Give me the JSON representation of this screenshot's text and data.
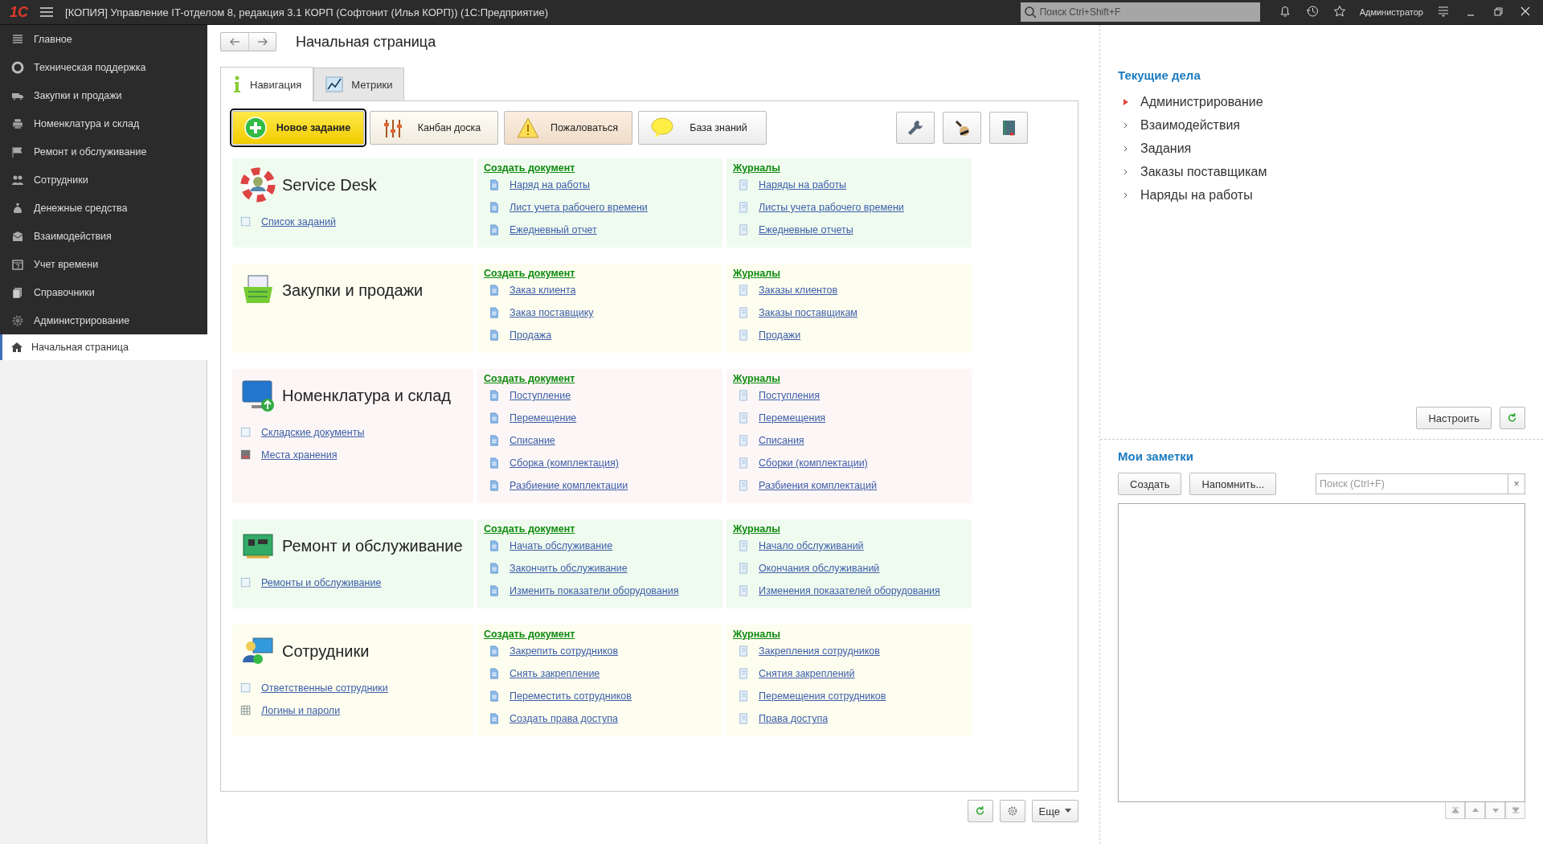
{
  "window": {
    "logo": "1С",
    "title": "[КОПИЯ] Управление IT-отделом 8, редакция 3.1 КОРП (Софтонит (Илья КОРП))  (1С:Предприятие)",
    "search": {
      "placeholder": "Поиск Ctrl+Shift+F"
    },
    "user": "Администратор"
  },
  "sidebar": {
    "items": [
      {
        "label": "Главное",
        "selected": false
      },
      {
        "label": "Техническая поддержка",
        "selected": false
      },
      {
        "label": "Закупки и продажи",
        "selected": false
      },
      {
        "label": "Номенклатура и склад",
        "selected": false
      },
      {
        "label": "Ремонт и обслуживание",
        "selected": false
      },
      {
        "label": "Сотрудники",
        "selected": false
      },
      {
        "label": "Денежные средства",
        "selected": false
      },
      {
        "label": "Взаимодействия",
        "selected": false
      },
      {
        "label": "Учет времени",
        "selected": false
      },
      {
        "label": "Справочники",
        "selected": false
      },
      {
        "label": "Администрирование",
        "selected": false
      },
      {
        "label": "Начальная страница",
        "selected": true
      }
    ]
  },
  "page": {
    "title": "Начальная страница",
    "tabs": [
      {
        "label": "Навигация",
        "selected": true
      },
      {
        "label": "Метрики",
        "selected": false
      }
    ],
    "actions": [
      {
        "label": "Новое задание",
        "kind": "primary"
      },
      {
        "label": "Канбан доска",
        "kind": "kanban"
      },
      {
        "label": "Пожаловаться",
        "kind": "warning"
      },
      {
        "label": "База знаний",
        "kind": "help"
      }
    ],
    "sections": [
      {
        "title": "Service Desk",
        "color": "#f0fbf0",
        "links": [
          {
            "label": "Список заданий",
            "kind": "list"
          }
        ],
        "create": {
          "heading": "Создать документ",
          "links": [
            "Наряд на работы",
            "Лист учета рабочего времени",
            "Ежедневный отчет"
          ]
        },
        "journals": {
          "heading": "Журналы",
          "links": [
            "Наряды на работы",
            "Листы учета рабочего времени",
            "Ежедневные отчеты"
          ]
        }
      },
      {
        "title": "Закупки и продажи",
        "color": "#fdfdf0",
        "create": {
          "heading": "Создать документ",
          "links": [
            "Заказ клиента",
            "Заказ поставщику",
            "Продажа"
          ]
        },
        "journals": {
          "heading": "Журналы",
          "links": [
            "Заказы клиентов",
            "Заказы поставщикам",
            "Продажи"
          ]
        }
      },
      {
        "title": "Номенклатура и склад",
        "color": "#fdf6f6",
        "links": [
          {
            "label": "Складские документы",
            "kind": "list"
          },
          {
            "label": "Места хранения",
            "kind": "storage"
          }
        ],
        "create": {
          "heading": "Создать документ",
          "links": [
            "Поступление",
            "Перемещение",
            "Списание",
            "Сборка (комплектация)",
            "Разбиение комплектации"
          ]
        },
        "journals": {
          "heading": "Журналы",
          "links": [
            "Поступления",
            "Перемещения",
            "Списания",
            "Сборки (комплектации)",
            "Разбиения комплектаций"
          ]
        }
      },
      {
        "title": "Ремонт и обслуживание",
        "color": "#f0fbf0",
        "links": [
          {
            "label": "Ремонты и обслуживание",
            "kind": "list"
          }
        ],
        "create": {
          "heading": "Создать документ",
          "links": [
            "Начать обслуживание",
            "Закончить обслуживание",
            "Изменить показатели оборудования"
          ]
        },
        "journals": {
          "heading": "Журналы",
          "links": [
            "Начало обслуживаний",
            "Окончания обслуживаний",
            "Изменения показателей оборудования"
          ]
        }
      },
      {
        "title": "Сотрудники",
        "color": "#fdfdf0",
        "links": [
          {
            "label": "Ответственные сотрудники",
            "kind": "list"
          },
          {
            "label": "Логины и пароли",
            "kind": "table"
          }
        ],
        "create": {
          "heading": "Создать документ",
          "links": [
            "Закрепить сотрудников",
            "Снять закрепление",
            "Переместить сотрудников",
            "Создать права доступа"
          ]
        },
        "journals": {
          "heading": "Журналы",
          "links": [
            "Закрепления сотрудников",
            "Снятия закреплений",
            "Перемещения сотрудников",
            "Права доступа"
          ]
        }
      }
    ],
    "more_button": "Еще"
  },
  "current_tasks": {
    "title": "Текущие дела",
    "items": [
      {
        "label": "Администрирование",
        "highlighted": true
      },
      {
        "label": "Взаимодействия",
        "highlighted": false
      },
      {
        "label": "Задания",
        "highlighted": false
      },
      {
        "label": "Заказы поставщикам",
        "highlighted": false
      },
      {
        "label": "Наряды на работы",
        "highlighted": false
      }
    ],
    "configure_button": "Настроить"
  },
  "notes": {
    "title": "Мои заметки",
    "buttons": [
      "Создать",
      "Напомнить..."
    ],
    "search": {
      "placeholder": "Поиск (Ctrl+F)"
    },
    "clear": "×"
  }
}
